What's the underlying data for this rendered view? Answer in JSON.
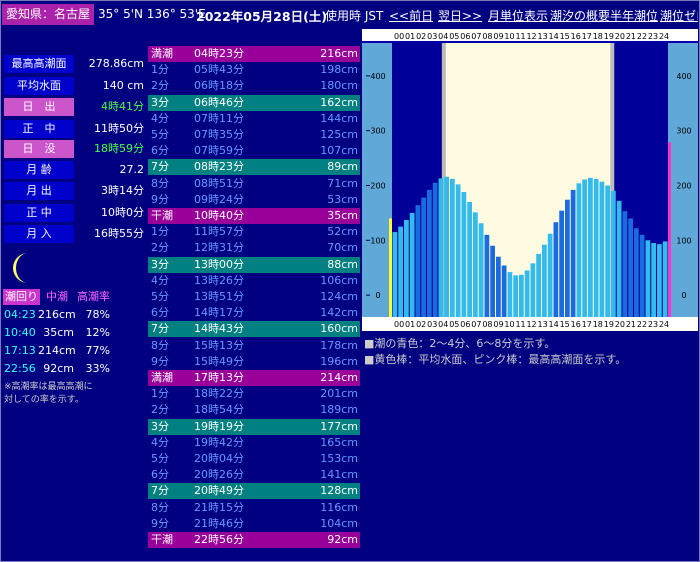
{
  "header": {
    "place": "愛知県：名古屋",
    "coords": "35° 5'N 136° 53'E",
    "date": "2022年05月28日(土)",
    "tz": "使用時 JST",
    "prev": "<<前日",
    "next": "翌日>>",
    "month_view": "月単位表示",
    "overview": "潮汐の概要",
    "halfyear": "半年潮位",
    "zero": "潮位ゼロ"
  },
  "info": [
    {
      "label": "最高高潮面",
      "value": "278.86cm",
      "style": "blue",
      "vstyle": "normal"
    },
    {
      "label": "平均水面",
      "value": "140 cm",
      "style": "blue",
      "vstyle": "normal"
    },
    {
      "label": "日　出",
      "value": "4時41分",
      "style": "pink",
      "vstyle": "green"
    },
    {
      "label": "正　中",
      "value": "11時50分",
      "style": "blue",
      "vstyle": "normal"
    },
    {
      "label": "日　没",
      "value": "18時59分",
      "style": "pink",
      "vstyle": "green"
    },
    {
      "label": "月 齢",
      "value": "27.2",
      "style": "blue",
      "vstyle": "normal"
    },
    {
      "label": "月 出",
      "value": "3時14分",
      "style": "blue",
      "vstyle": "normal"
    },
    {
      "label": "正 中",
      "value": "10時0分",
      "style": "blue",
      "vstyle": "normal"
    },
    {
      "label": "月 入",
      "value": "16時55分",
      "style": "blue",
      "vstyle": "normal"
    }
  ],
  "tide_list": {
    "h1": "潮回り",
    "h2": "中潮",
    "h3": "高潮率",
    "rows": [
      {
        "time": "04:23",
        "height": "216cm",
        "pct": "78%"
      },
      {
        "time": "10:40",
        "height": "35cm",
        "pct": "12%"
      },
      {
        "time": "17:13",
        "height": "214cm",
        "pct": "77%"
      },
      {
        "time": "22:56",
        "height": "92cm",
        "pct": "33%"
      }
    ],
    "note1": "※高潮率は最高高潮に",
    "note2": "対しての率を示す。"
  },
  "table": [
    {
      "a": "満潮",
      "b": "04時23分",
      "c": "216cm",
      "t": "mag"
    },
    {
      "a": "1分",
      "b": "05時43分",
      "c": "198cm",
      "t": "plain"
    },
    {
      "a": "2分",
      "b": "06時18分",
      "c": "180cm",
      "t": "plain"
    },
    {
      "a": "3分",
      "b": "06時46分",
      "c": "162cm",
      "t": "teal"
    },
    {
      "a": "4分",
      "b": "07時11分",
      "c": "144cm",
      "t": "plain"
    },
    {
      "a": "5分",
      "b": "07時35分",
      "c": "125cm",
      "t": "plain"
    },
    {
      "a": "6分",
      "b": "07時59分",
      "c": "107cm",
      "t": "plain"
    },
    {
      "a": "7分",
      "b": "08時23分",
      "c": "89cm",
      "t": "teal"
    },
    {
      "a": "8分",
      "b": "08時51分",
      "c": "71cm",
      "t": "plain"
    },
    {
      "a": "9分",
      "b": "09時24分",
      "c": "53cm",
      "t": "plain"
    },
    {
      "a": "干潮",
      "b": "10時40分",
      "c": "35cm",
      "t": "mag"
    },
    {
      "a": "1分",
      "b": "11時57分",
      "c": "52cm",
      "t": "plain"
    },
    {
      "a": "2分",
      "b": "12時31分",
      "c": "70cm",
      "t": "plain"
    },
    {
      "a": "3分",
      "b": "13時00分",
      "c": "88cm",
      "t": "teal"
    },
    {
      "a": "4分",
      "b": "13時26分",
      "c": "106cm",
      "t": "plain"
    },
    {
      "a": "5分",
      "b": "13時51分",
      "c": "124cm",
      "t": "plain"
    },
    {
      "a": "6分",
      "b": "14時17分",
      "c": "142cm",
      "t": "plain"
    },
    {
      "a": "7分",
      "b": "14時43分",
      "c": "160cm",
      "t": "teal"
    },
    {
      "a": "8分",
      "b": "15時13分",
      "c": "178cm",
      "t": "plain"
    },
    {
      "a": "9分",
      "b": "15時49分",
      "c": "196cm",
      "t": "plain"
    },
    {
      "a": "満潮",
      "b": "17時13分",
      "c": "214cm",
      "t": "mag"
    },
    {
      "a": "1分",
      "b": "18時22分",
      "c": "201cm",
      "t": "plain"
    },
    {
      "a": "2分",
      "b": "18時54分",
      "c": "189cm",
      "t": "plain"
    },
    {
      "a": "3分",
      "b": "19時19分",
      "c": "177cm",
      "t": "teal"
    },
    {
      "a": "4分",
      "b": "19時42分",
      "c": "165cm",
      "t": "plain"
    },
    {
      "a": "5分",
      "b": "20時04分",
      "c": "153cm",
      "t": "plain"
    },
    {
      "a": "6分",
      "b": "20時26分",
      "c": "141cm",
      "t": "plain"
    },
    {
      "a": "7分",
      "b": "20時49分",
      "c": "128cm",
      "t": "teal"
    },
    {
      "a": "8分",
      "b": "21時15分",
      "c": "116cm",
      "t": "plain"
    },
    {
      "a": "9分",
      "b": "21時46分",
      "c": "104cm",
      "t": "plain"
    },
    {
      "a": "干潮",
      "b": "22時56分",
      "c": "92cm",
      "t": "mag"
    }
  ],
  "chart_data": {
    "type": "bar",
    "x_ticks": [
      "00",
      "01",
      "02",
      "03",
      "04",
      "05",
      "06",
      "07",
      "08",
      "09",
      "10",
      "11",
      "12",
      "13",
      "14",
      "15",
      "16",
      "17",
      "18",
      "19",
      "20",
      "21",
      "22",
      "23",
      "24"
    ],
    "y_ticks": [
      0,
      100,
      200,
      300,
      400
    ],
    "ylim": [
      -40,
      460
    ],
    "sunrise_hour": 4.68,
    "sunset_hour": 18.98,
    "mean_level": 140,
    "highest_high_water": 278.86,
    "series": [
      {
        "hour": 0.0,
        "value": 115
      },
      {
        "hour": 0.5,
        "value": 125
      },
      {
        "hour": 1.0,
        "value": 137
      },
      {
        "hour": 1.5,
        "value": 150
      },
      {
        "hour": 2.0,
        "value": 164
      },
      {
        "hour": 2.5,
        "value": 178
      },
      {
        "hour": 3.0,
        "value": 192
      },
      {
        "hour": 3.5,
        "value": 205
      },
      {
        "hour": 4.0,
        "value": 213
      },
      {
        "hour": 4.5,
        "value": 216
      },
      {
        "hour": 5.0,
        "value": 212
      },
      {
        "hour": 5.5,
        "value": 202
      },
      {
        "hour": 6.0,
        "value": 188
      },
      {
        "hour": 6.5,
        "value": 170
      },
      {
        "hour": 7.0,
        "value": 151
      },
      {
        "hour": 7.5,
        "value": 131
      },
      {
        "hour": 8.0,
        "value": 110
      },
      {
        "hour": 8.5,
        "value": 90
      },
      {
        "hour": 9.0,
        "value": 70
      },
      {
        "hour": 9.5,
        "value": 54
      },
      {
        "hour": 10.0,
        "value": 42
      },
      {
        "hour": 10.5,
        "value": 36
      },
      {
        "hour": 11.0,
        "value": 37
      },
      {
        "hour": 11.5,
        "value": 45
      },
      {
        "hour": 12.0,
        "value": 58
      },
      {
        "hour": 12.5,
        "value": 75
      },
      {
        "hour": 13.0,
        "value": 92
      },
      {
        "hour": 13.5,
        "value": 112
      },
      {
        "hour": 14.0,
        "value": 133
      },
      {
        "hour": 14.5,
        "value": 154
      },
      {
        "hour": 15.0,
        "value": 174
      },
      {
        "hour": 15.5,
        "value": 192
      },
      {
        "hour": 16.0,
        "value": 204
      },
      {
        "hour": 16.5,
        "value": 211
      },
      {
        "hour": 17.0,
        "value": 214
      },
      {
        "hour": 17.5,
        "value": 212
      },
      {
        "hour": 18.0,
        "value": 207
      },
      {
        "hour": 18.5,
        "value": 200
      },
      {
        "hour": 19.0,
        "value": 190
      },
      {
        "hour": 19.5,
        "value": 172
      },
      {
        "hour": 20.0,
        "value": 153
      },
      {
        "hour": 20.5,
        "value": 140
      },
      {
        "hour": 21.0,
        "value": 122
      },
      {
        "hour": 21.5,
        "value": 110
      },
      {
        "hour": 22.0,
        "value": 100
      },
      {
        "hour": 22.5,
        "value": 95
      },
      {
        "hour": 23.0,
        "value": 93
      },
      {
        "hour": 23.5,
        "value": 98
      }
    ]
  },
  "legend1": "■潮の青色：2〜4分、6〜8分を示す。",
  "legend2": "■黄色棒：平均水面、ピンク棒：最高高潮面を示す。"
}
